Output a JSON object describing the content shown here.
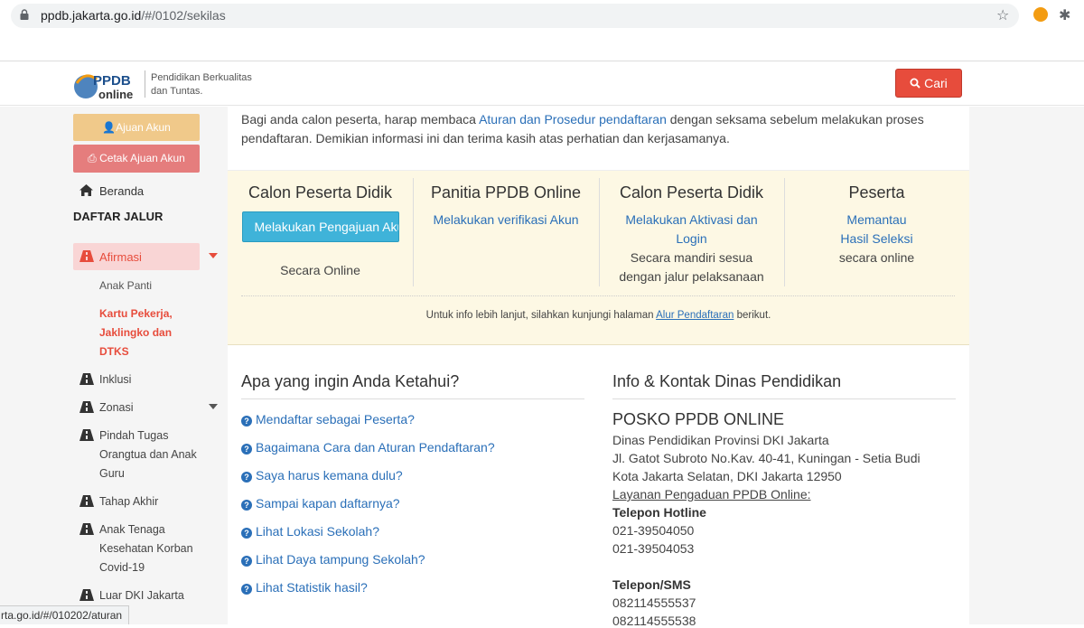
{
  "browser": {
    "url_host": "ppdb.jakarta.go.id",
    "url_path": "/#/0102/sekilas"
  },
  "header": {
    "logo_text": "PPDB Online",
    "tagline_line1": "Pendidikan Berkualitas",
    "tagline_line2": "dan Tuntas.",
    "search_label": "Cari"
  },
  "sidebar": {
    "ajuan_label": "Ajuan Akun",
    "cetak_label": "Cetak Ajuan Akun",
    "beranda_label": "Beranda",
    "daftar_title": "DAFTAR JALUR",
    "afirmasi_label": "Afirmasi",
    "afirmasi_sub1": "Anak Panti",
    "afirmasi_sub2_l1": "Kartu Pekerja,",
    "afirmasi_sub2_l2": "Jaklingko dan",
    "afirmasi_sub2_l3": "DTKS",
    "inklusi": "Inklusi",
    "zonasi": "Zonasi",
    "pindah_l1": "Pindah Tugas",
    "pindah_l2": "Orangtua dan Anak",
    "pindah_l3": "Guru",
    "tahap_akhir": "Tahap Akhir",
    "anak_nakes_l1": "Anak Tenaga",
    "anak_nakes_l2": "Kesehatan Korban",
    "anak_nakes_l3": "Covid-19",
    "luar_dki": "Luar DKI Jakarta"
  },
  "intro": {
    "pre": "Bagi anda calon peserta, harap membaca ",
    "link": "Aturan dan Prosedur pendaftaran",
    "post": " dengan seksama sebelum melakukan proses pendaftaran. Demikian informasi ini dan terima kasih atas perhatian dan kerjasamanya."
  },
  "steps": [
    {
      "title": "Calon Peserta Didik",
      "button": "Melakukan Pengajuan Akun",
      "plain": "Secara Online"
    },
    {
      "title": "Panitia PPDB Online",
      "link": "Melakukan verifikasi Akun"
    },
    {
      "title": "Calon Peserta Didik",
      "link_l1": "Melakukan Aktivasi dan",
      "link_l2": "Login",
      "plain_l1": "Secara mandiri sesua",
      "plain_l2": "dengan jalur pelaksanaan"
    },
    {
      "title": "Peserta",
      "link_l1": "Memantau",
      "link_l2": "Hasil Seleksi",
      "plain": "secara online"
    }
  ],
  "steps_note": {
    "pre": "Untuk info lebih lanjut, silahkan kunjungi halaman ",
    "link": "Alur Pendaftaran",
    "post": " berikut."
  },
  "faq": {
    "title": "Apa yang ingin Anda Ketahui?",
    "items": [
      "Mendaftar sebagai Peserta?",
      "Bagaimana Cara dan Aturan Pendaftaran?",
      "Saya harus kemana dulu?",
      "Sampai kapan daftarnya?",
      "Lihat Lokasi Sekolah?",
      "Lihat Daya tampung Sekolah?",
      "Lihat Statistik hasil?"
    ]
  },
  "info": {
    "title": "Info & Kontak Dinas Pendidikan",
    "posko": "POSKO PPDB ONLINE",
    "line1": "Dinas Pendidikan Provinsi DKI Jakarta",
    "line2": "Jl. Gatot Subroto No.Kav. 40-41, Kuningan - Setia Budi",
    "line3": "Kota Jakarta Selatan, DKI Jakarta 12950",
    "layanan": "Layanan Pengaduan PPDB Online:",
    "hotline_label": "Telepon Hotline",
    "hotline1": "021-39504050",
    "hotline2": "021-39504053",
    "sms_label": "Telepon/SMS",
    "sms1": "082114555537",
    "sms2": "082114555538"
  },
  "statusbar": "rta.go.id/#/010202/aturan"
}
